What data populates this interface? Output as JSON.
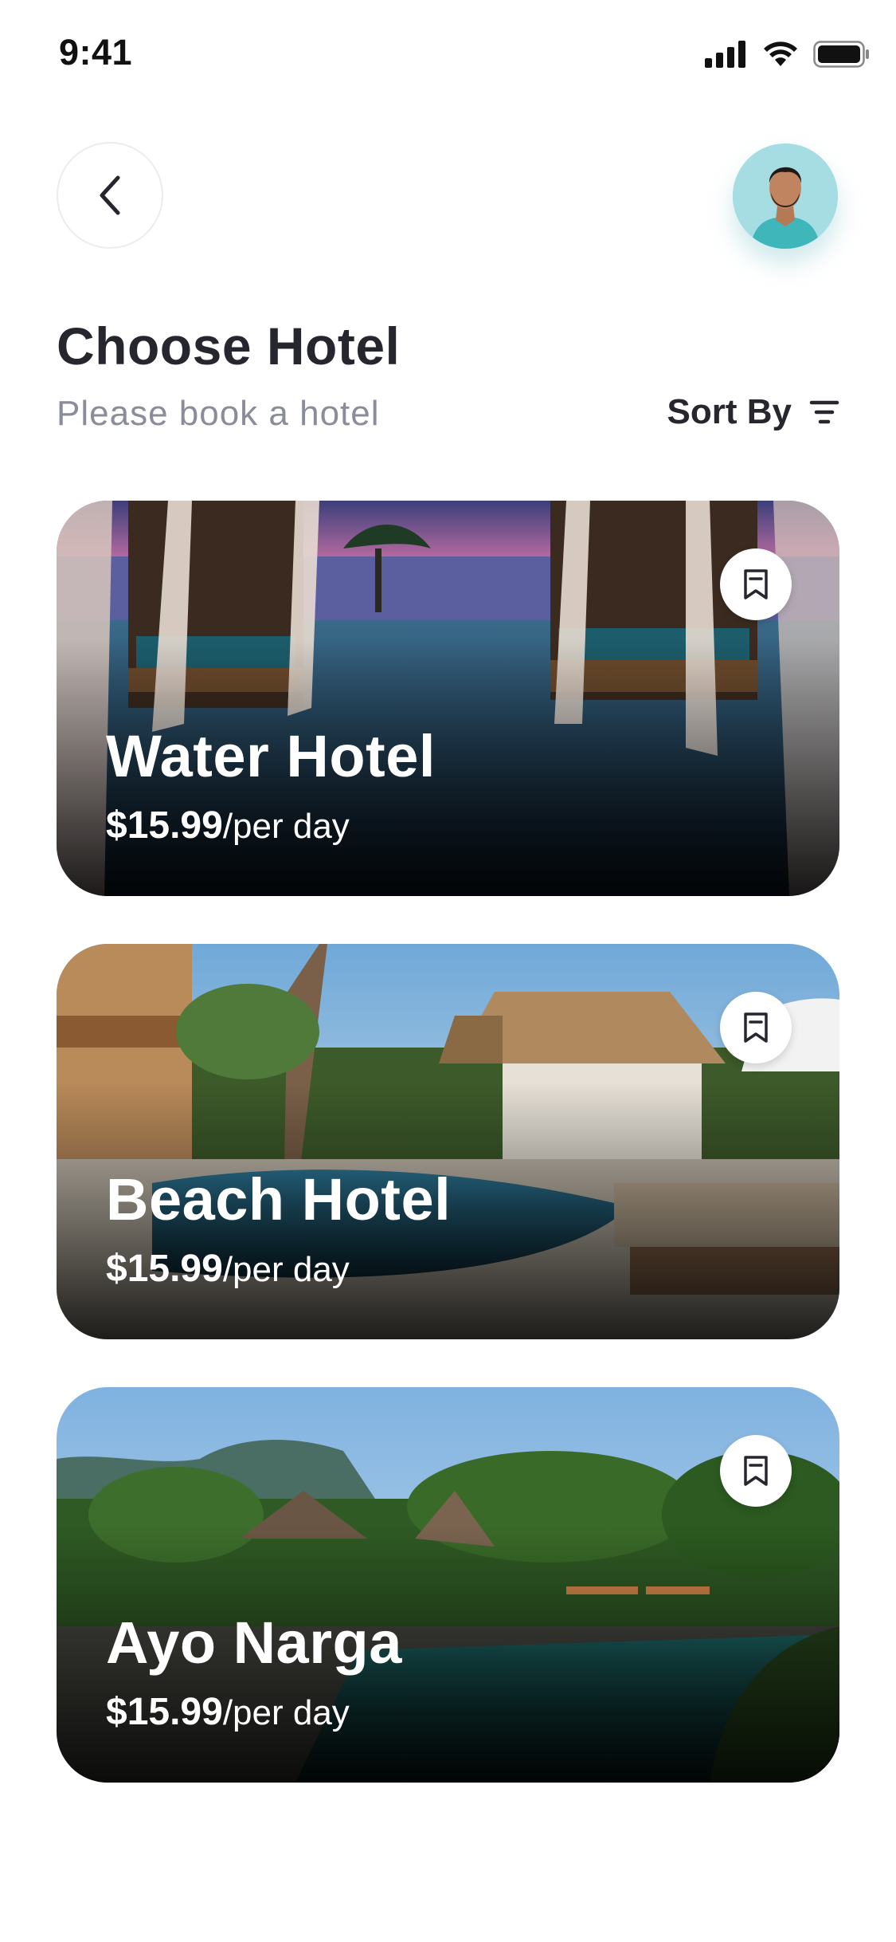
{
  "status_bar": {
    "time": "9:41",
    "icons": [
      "signal-icon",
      "wifi-icon",
      "battery-icon"
    ]
  },
  "header": {
    "back_icon": "chevron-left-icon",
    "avatar": "user-avatar"
  },
  "page": {
    "title": "Choose Hotel",
    "subtitle": "Please book a hotel",
    "sort_label": "Sort By",
    "sort_icon": "filter-lines-icon"
  },
  "hotels": [
    {
      "name": "Water Hotel",
      "price": "$15.99",
      "unit": "/per day",
      "bookmark_icon": "bookmark-icon"
    },
    {
      "name": "Beach Hotel",
      "price": "$15.99",
      "unit": "/per day",
      "bookmark_icon": "bookmark-icon"
    },
    {
      "name": "Ayo Narga",
      "price": "$15.99",
      "unit": "/per day",
      "bookmark_icon": "bookmark-icon"
    }
  ],
  "colors": {
    "title": "#26262f",
    "subtitle": "#8a8d99",
    "avatar_bg": "#9fd9e0",
    "card_text": "#ffffff"
  }
}
